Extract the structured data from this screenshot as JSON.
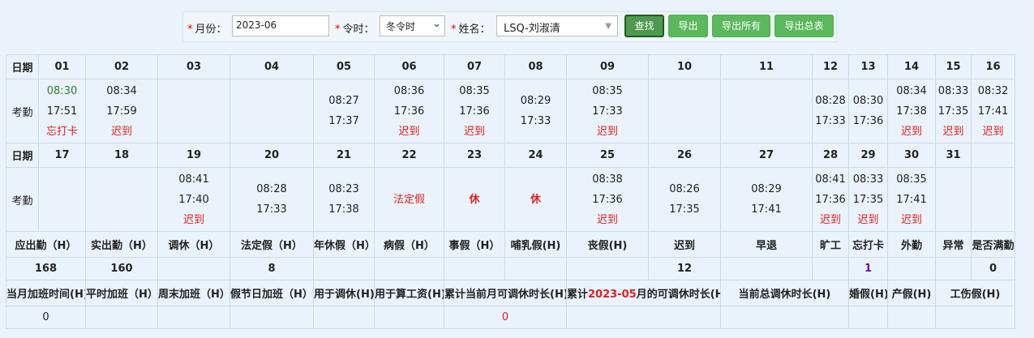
{
  "filter": {
    "month_label": "月份：",
    "month_value": "2023-06",
    "season_label": "令时：",
    "season_value": "冬令时",
    "name_label": "姓名：",
    "name_value": "LSQ-刘淑清",
    "required_mark": "*",
    "search_label": "查找",
    "export_label": "导出",
    "export_all_label": "导出所有",
    "export_summary_label": "导出总表"
  },
  "row_labels": {
    "date": "日期",
    "attendance": "考勤"
  },
  "week1": {
    "dates": [
      "01",
      "02",
      "03",
      "04",
      "05",
      "06",
      "07",
      "08",
      "09",
      "10",
      "11",
      "12",
      "13",
      "14",
      "15",
      "16"
    ],
    "cells": [
      {
        "in": "08:30",
        "out": "17:51",
        "note": "忘打卡"
      },
      {
        "in": "08:34",
        "out": "17:59",
        "note": "迟到"
      },
      {
        "in": "",
        "out": "",
        "note": ""
      },
      {
        "in": "",
        "out": "",
        "note": ""
      },
      {
        "in": "08:27",
        "out": "17:37",
        "note": ""
      },
      {
        "in": "08:36",
        "out": "17:36",
        "note": "迟到"
      },
      {
        "in": "08:35",
        "out": "17:36",
        "note": "迟到"
      },
      {
        "in": "08:29",
        "out": "17:33",
        "note": ""
      },
      {
        "in": "08:35",
        "out": "17:33",
        "note": "迟到"
      },
      {
        "in": "",
        "out": "",
        "note": ""
      },
      {
        "in": "",
        "out": "",
        "note": ""
      },
      {
        "in": "08:28",
        "out": "17:33",
        "note": ""
      },
      {
        "in": "08:30",
        "out": "17:36",
        "note": ""
      },
      {
        "in": "08:34",
        "out": "17:38",
        "note": "迟到"
      },
      {
        "in": "08:33",
        "out": "17:35",
        "note": "迟到"
      },
      {
        "in": "08:32",
        "out": "17:41",
        "note": "迟到"
      }
    ]
  },
  "week2": {
    "dates": [
      "17",
      "18",
      "19",
      "20",
      "21",
      "22",
      "23",
      "24",
      "25",
      "26",
      "27",
      "28",
      "29",
      "30",
      "31",
      ""
    ],
    "cells": [
      {
        "in": "",
        "out": "",
        "note": ""
      },
      {
        "in": "",
        "out": "",
        "note": ""
      },
      {
        "in": "08:41",
        "out": "17:40",
        "note": "迟到"
      },
      {
        "in": "08:28",
        "out": "17:33",
        "note": ""
      },
      {
        "in": "08:23",
        "out": "17:38",
        "note": ""
      },
      {
        "special": "法定假"
      },
      {
        "special": "休"
      },
      {
        "special": "休"
      },
      {
        "in": "08:38",
        "out": "17:36",
        "note": "迟到"
      },
      {
        "in": "08:26",
        "out": "17:35",
        "note": ""
      },
      {
        "in": "08:29",
        "out": "17:41",
        "note": ""
      },
      {
        "in": "08:41",
        "out": "17:36",
        "note": "迟到"
      },
      {
        "in": "08:33",
        "out": "17:35",
        "note": "迟到"
      },
      {
        "in": "08:35",
        "out": "17:41",
        "note": "迟到"
      },
      {
        "in": "",
        "out": "",
        "note": ""
      },
      {
        "in": "",
        "out": "",
        "note": ""
      }
    ]
  },
  "stats": {
    "headers": [
      "应出勤（H）",
      "实出勤（H）",
      "调休（H）",
      "法定假（H）",
      "年休假（H）",
      "病假（H）",
      "事假（H）",
      "哺乳假(H)",
      "丧假(H)",
      "迟到",
      "早退",
      "旷工",
      "忘打卡",
      "外勤",
      "异常",
      "是否满勤"
    ],
    "values": [
      "168",
      "160",
      "",
      "8",
      "",
      "",
      "",
      "",
      "",
      "12",
      "",
      "",
      "1",
      "",
      "",
      "0"
    ]
  },
  "overtime": {
    "h1": "当月加班时间(H)",
    "h2": "平时加班（H）",
    "h3": "周末加班（H）",
    "h4": "假节日加班（H）",
    "h5": "用于调休(H)",
    "h6": "用于算工资(H)",
    "h7": "累计当前月可调休时长(H)",
    "h8_pre": "累计",
    "h8_month": "2023-05",
    "h8_post": "月的可调休时长(H)",
    "h9": "当前总调休时长(H)",
    "h10": "婚假(H)",
    "h11": "产假(H)",
    "h12": "工伤假(H)",
    "v1": "0",
    "v7": "0"
  },
  "colors": {
    "background": "#eaf3fb",
    "button_green": "#5cb85c",
    "late_red": "#e02020",
    "forgot_green": "#2e7d32",
    "count_purple": "#6a0dad"
  }
}
